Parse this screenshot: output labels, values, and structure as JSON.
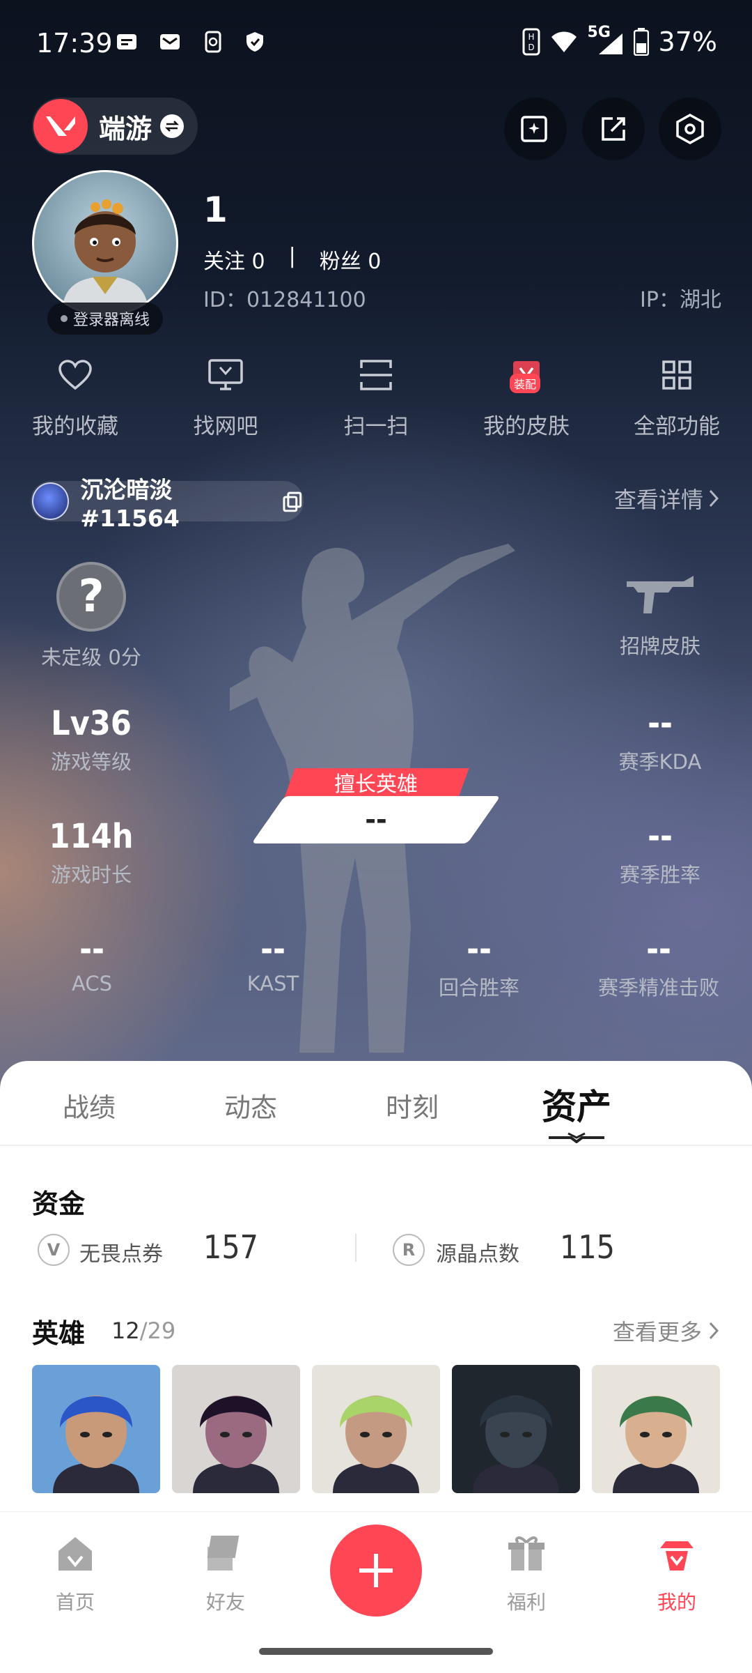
{
  "status_bar": {
    "time": "17:39",
    "network": "5G",
    "battery": "37%"
  },
  "header": {
    "game_name": "端游"
  },
  "profile": {
    "nickname": "1",
    "follow_label": "关注",
    "follow_count": "0",
    "fans_label": "粉丝",
    "fans_count": "0",
    "separator": "|",
    "id_text": "ID：012841100",
    "ip_text": "IP：湖北",
    "login_status": "登录器离线"
  },
  "functions": [
    {
      "label": "我的收藏",
      "icon": "heart-icon"
    },
    {
      "label": "找网吧",
      "icon": "monitor-icon"
    },
    {
      "label": "扫一扫",
      "icon": "scan-icon"
    },
    {
      "label": "我的皮肤",
      "icon": "skin-icon",
      "tag": "装配"
    },
    {
      "label": "全部功能",
      "icon": "grid-icon"
    }
  ],
  "riot_account": {
    "name": "沉沦暗淡#11564",
    "detail_link": "查看详情"
  },
  "stats": {
    "rank_symbol": "?",
    "rank_label": "未定级 0分",
    "card_skin_label": "招牌皮肤",
    "level_value": "Lv36",
    "level_label": "游戏等级",
    "kda_value": "--",
    "kda_label": "赛季KDA",
    "hours_value": "114h",
    "hours_label": "游戏时长",
    "winrate_value": "--",
    "winrate_label": "赛季胜率",
    "main_hero_label": "擅长英雄",
    "main_hero_value": "--",
    "acs_value": "--",
    "acs_label": "ACS",
    "kast_value": "--",
    "kast_label": "KAST",
    "round_win_value": "--",
    "round_win_label": "回合胜率",
    "precise_value": "--",
    "precise_label": "赛季精准击败"
  },
  "tabs": [
    {
      "label": "战绩",
      "active": false
    },
    {
      "label": "动态",
      "active": false
    },
    {
      "label": "时刻",
      "active": false
    },
    {
      "label": "资产",
      "active": true
    }
  ],
  "assets": {
    "funds_title": "资金",
    "vp_label": "无畏点券",
    "vp_value": "157",
    "rp_label": "源晶点数",
    "rp_value": "115",
    "heroes_title": "英雄",
    "heroes_owned": "12",
    "heroes_sep": "/",
    "heroes_total": "29",
    "more_link": "查看更多"
  },
  "agent_cards": [
    {
      "icon": "agent-portrait-neon",
      "hair": "#2a57c8",
      "skin": "#c99a7a",
      "bg": "#6aa0d8"
    },
    {
      "icon": "agent-portrait-reyna",
      "hair": "#1d1228",
      "skin": "#9a6a80",
      "bg": "#d9d5d2"
    },
    {
      "icon": "agent-portrait-gekko",
      "hair": "#a9d46a",
      "skin": "#c59a82",
      "bg": "#e6e2dc"
    },
    {
      "icon": "agent-portrait-kayo",
      "hair": "#2a3340",
      "skin": "#3a4450",
      "bg": "#20262e"
    },
    {
      "icon": "agent-portrait-killjoy",
      "hair": "#3a7a4a",
      "skin": "#d8b090",
      "bg": "#e8e4dc"
    }
  ],
  "bottom_nav": [
    {
      "label": "首页",
      "active": false
    },
    {
      "label": "好友",
      "active": false
    },
    {
      "label": "福利",
      "active": false
    },
    {
      "label": "我的",
      "active": true
    }
  ],
  "colors": {
    "accent": "#fe4655",
    "sheet_bg": "#ffffff"
  }
}
